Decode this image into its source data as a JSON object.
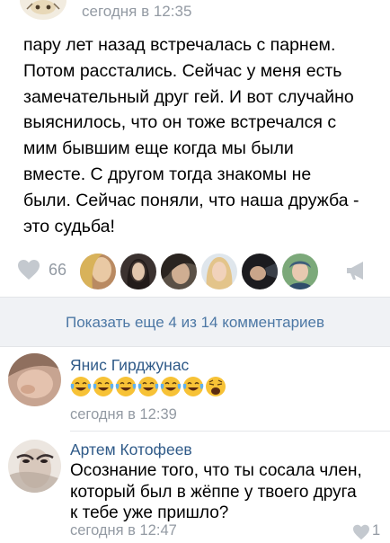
{
  "post": {
    "time": "сегодня в 12:35",
    "text": "пару лет назад встречалась с парнем.\nПотом расстались. Сейчас у меня есть\nзамечательный друг гей. И вот случайно\nвыяснилось, что он тоже встречался с\nмим бывшим еще когда мы были\nвместе. С другом тогда знакомы не\nбыли. Сейчас поняли, что наша дружба -\nэто судьба!",
    "likes": "66",
    "icons": {
      "like": "heart-icon",
      "share": "megaphone-icon"
    },
    "likers": [
      "liker-1",
      "liker-2",
      "liker-3",
      "liker-4",
      "liker-5",
      "liker-6"
    ]
  },
  "show_more": {
    "label": "Показать еще 4 из 14 комментариев"
  },
  "comments": [
    {
      "author": "Янис Гирджунас",
      "emojis": [
        "face-with-tears-of-joy",
        "face-with-tears-of-joy",
        "face-with-tears-of-joy",
        "face-with-tears-of-joy",
        "face-with-tears-of-joy",
        "face-with-tears-of-joy",
        "weary-face"
      ],
      "time": "сегодня в 12:39"
    },
    {
      "author": "Артем Котофеев",
      "text": "Осознание того, что ты сосала член,\nкоторый был в жёппе у твоего друга\nк тебе уже пришло?",
      "time": "сегодня в 12:47",
      "likes": "1"
    }
  ],
  "colors": {
    "link": "#2f5a88",
    "accent_blue": "#4d78a5",
    "meta_gray": "#939aa3",
    "bar_background": "#f0f2f5",
    "emoji_yellow": "#f7c236",
    "tear_blue": "#5fb1ee"
  }
}
